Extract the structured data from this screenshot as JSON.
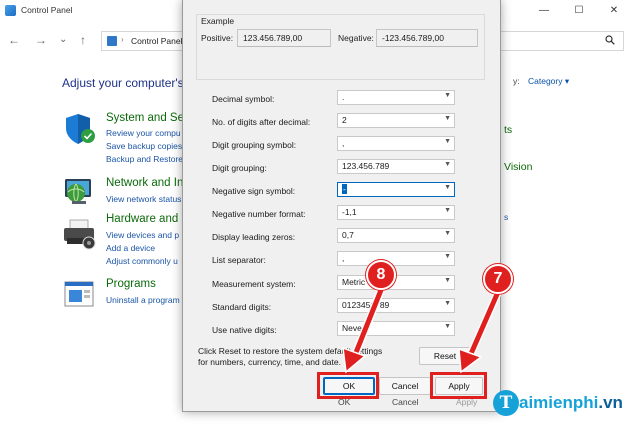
{
  "window": {
    "title": "Control Panel",
    "controls": {
      "minimize": "—",
      "maximize": "☐",
      "close": "✕"
    }
  },
  "navbar": {
    "back": "←",
    "forward": "→",
    "recent": "⌄",
    "up": "↑",
    "address_sep": "›",
    "address_text": "Control Panel"
  },
  "main": {
    "heading": "Adjust your computer's",
    "view_by_label": "y:",
    "view_by_value": "Category ▾",
    "categories": [
      {
        "title": "System and Se",
        "links": [
          "Review your compu",
          "Save backup copies",
          "Backup and Restore"
        ],
        "icon": "shield-icon"
      },
      {
        "title": "Network and In",
        "links": [
          "View network status"
        ],
        "icon": "network-globe-icon"
      },
      {
        "title": "Hardware and",
        "links": [
          "View devices and p",
          "Add a device",
          "Adjust commonly u"
        ],
        "icon": "printer-icon"
      },
      {
        "title": "Programs",
        "links": [
          "Uninstall a program"
        ],
        "icon": "programs-icon"
      }
    ],
    "right_partial": [
      "ts",
      "Vision",
      "s"
    ]
  },
  "dialog": {
    "example": {
      "label": "Example",
      "positive_label": "Positive:",
      "positive_value": "123.456.789,00",
      "negative_label": "Negative:",
      "negative_value": "-123.456.789,00"
    },
    "settings": [
      {
        "label": "Decimal symbol:",
        "value": "."
      },
      {
        "label": "No. of digits after decimal:",
        "value": "2"
      },
      {
        "label": "Digit grouping symbol:",
        "value": ","
      },
      {
        "label": "Digit grouping:",
        "value": "123.456.789"
      },
      {
        "label": "Negative sign symbol:",
        "value": "-"
      },
      {
        "label": "Negative number format:",
        "value": "-1,1"
      },
      {
        "label": "Display leading zeros:",
        "value": "0,7"
      },
      {
        "label": "List separator:",
        "value": ","
      },
      {
        "label": "Measurement system:",
        "value": "Metric"
      },
      {
        "label": "Standard digits:",
        "value": "0123456789"
      },
      {
        "label": "Use native digits:",
        "value": "Never"
      }
    ],
    "reset_text": "Click Reset to restore the system default settings for numbers, currency, time, and date.",
    "reset_button": "Reset",
    "ok_button": "OK",
    "cancel_button": "Cancel",
    "apply_button": "Apply",
    "ghost_ok": "OK",
    "ghost_cancel": "Cancel",
    "ghost_apply": "Apply"
  },
  "annotations": {
    "step_ok": "8",
    "step_apply": "7",
    "color": "#e0201f"
  },
  "watermark": {
    "logo_letter": "T",
    "brand_main": "aimienphi",
    "brand_tld": ".vn"
  }
}
